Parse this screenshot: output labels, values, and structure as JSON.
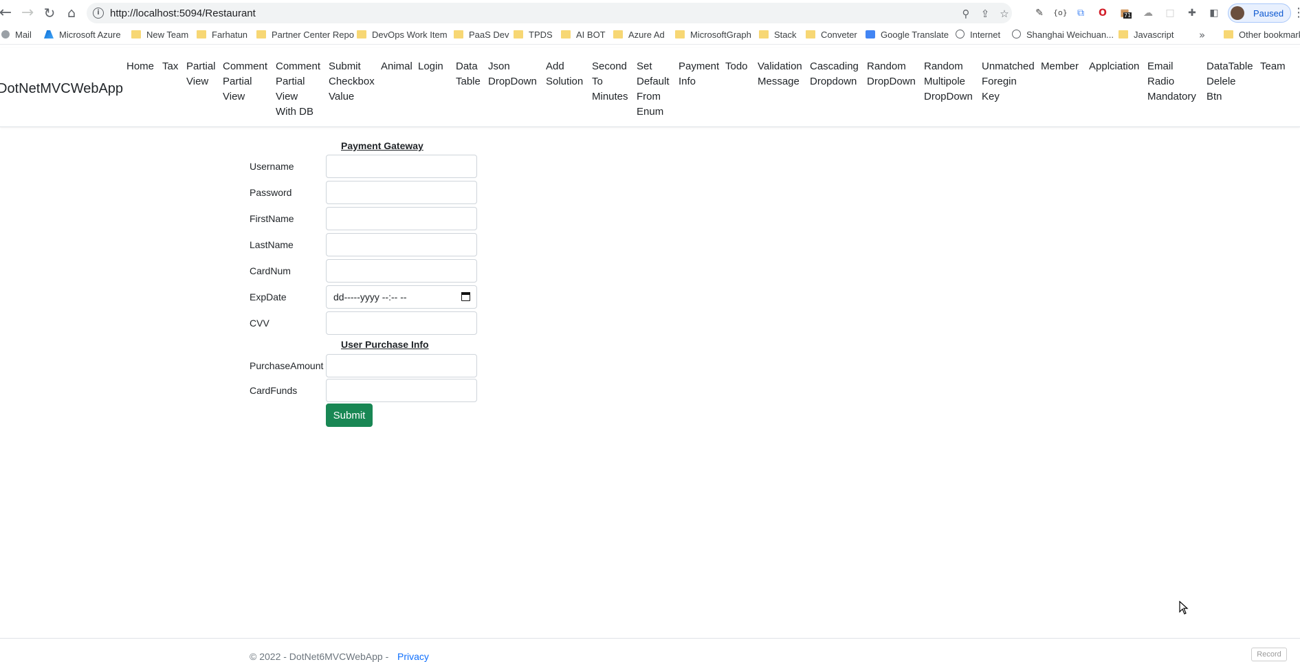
{
  "browser": {
    "url": "http://localhost:5094/Restaurant",
    "profile_status": "Paused",
    "extension_badge": "71",
    "bookmarks": [
      {
        "label": "Mail",
        "icon": "mail-icon"
      },
      {
        "label": "Microsoft Azure",
        "icon": "azure-icon"
      },
      {
        "label": "New Team",
        "icon": "folder-icon"
      },
      {
        "label": "Farhatun",
        "icon": "folder-icon"
      },
      {
        "label": "Partner Center Repo",
        "icon": "folder-icon"
      },
      {
        "label": "DevOps Work Item",
        "icon": "folder-icon"
      },
      {
        "label": "PaaS Dev",
        "icon": "folder-icon"
      },
      {
        "label": "TPDS",
        "icon": "folder-icon"
      },
      {
        "label": "AI BOT",
        "icon": "folder-icon"
      },
      {
        "label": "Azure Ad",
        "icon": "folder-icon"
      },
      {
        "label": "MicrosoftGraph",
        "icon": "folder-icon"
      },
      {
        "label": "Stack",
        "icon": "folder-icon"
      },
      {
        "label": "Conveter",
        "icon": "folder-icon"
      },
      {
        "label": "Google Translate",
        "icon": "google-translate-icon"
      },
      {
        "label": "Internet",
        "icon": "globe-icon"
      },
      {
        "label": "Shanghai Weichuan...",
        "icon": "globe-icon"
      },
      {
        "label": "Javascript",
        "icon": "folder-icon"
      }
    ],
    "bookmarks_more": "»",
    "other_bookmarks": "Other bookmarks"
  },
  "site": {
    "brand": "DotNetMVCWebApp",
    "nav": [
      {
        "label": "Home"
      },
      {
        "label": "Tax"
      },
      {
        "label": "Partial\nView"
      },
      {
        "label": "Comment\nPartial\nView"
      },
      {
        "label": "Comment\nPartial\nView\nWith DB"
      },
      {
        "label": "Submit\nCheckbox\nValue"
      },
      {
        "label": "Animal"
      },
      {
        "label": "Login"
      },
      {
        "label": "Data\nTable"
      },
      {
        "label": "Json\nDropDown"
      },
      {
        "label": "Add\nSolution"
      },
      {
        "label": "Second\nTo\nMinutes"
      },
      {
        "label": "Set\nDefault\nFrom\nEnum"
      },
      {
        "label": "Payment\nInfo"
      },
      {
        "label": "Todo"
      },
      {
        "label": "Validation\nMessage"
      },
      {
        "label": "Cascading\nDropdown"
      },
      {
        "label": "Random\nDropDown"
      },
      {
        "label": "Random\nMultipole\nDropDown"
      },
      {
        "label": "Unmatched\nForegin\nKey"
      },
      {
        "label": "Member"
      },
      {
        "label": "Applciation"
      },
      {
        "label": "Email\nRadio\nMandatory"
      },
      {
        "label": "DataTable\nDelele\nBtn"
      },
      {
        "label": "Team"
      }
    ]
  },
  "form": {
    "payment_title": "Payment Gateway",
    "purchase_title": "User Purchase Info",
    "fields": {
      "username": {
        "label": "Username",
        "value": ""
      },
      "password": {
        "label": "Password",
        "value": ""
      },
      "firstname": {
        "label": "FirstName",
        "value": ""
      },
      "lastname": {
        "label": "LastName",
        "value": ""
      },
      "cardnum": {
        "label": "CardNum",
        "value": ""
      },
      "expdate": {
        "label": "ExpDate",
        "value": "dd-----yyyy --:-- --"
      },
      "cvv": {
        "label": "CVV",
        "value": ""
      },
      "purchaseamount": {
        "label": "PurchaseAmount",
        "value": ""
      },
      "cardfunds": {
        "label": "CardFunds",
        "value": ""
      }
    },
    "submit_label": "Submit"
  },
  "footer": {
    "copyright": "© 2022 - DotNet6MVCWebApp -",
    "privacy_link": "Privacy",
    "record_label": "Record"
  },
  "colors": {
    "submit_green": "#198754",
    "link_blue": "#0d6efd",
    "folder_yellow": "#f7d774"
  }
}
